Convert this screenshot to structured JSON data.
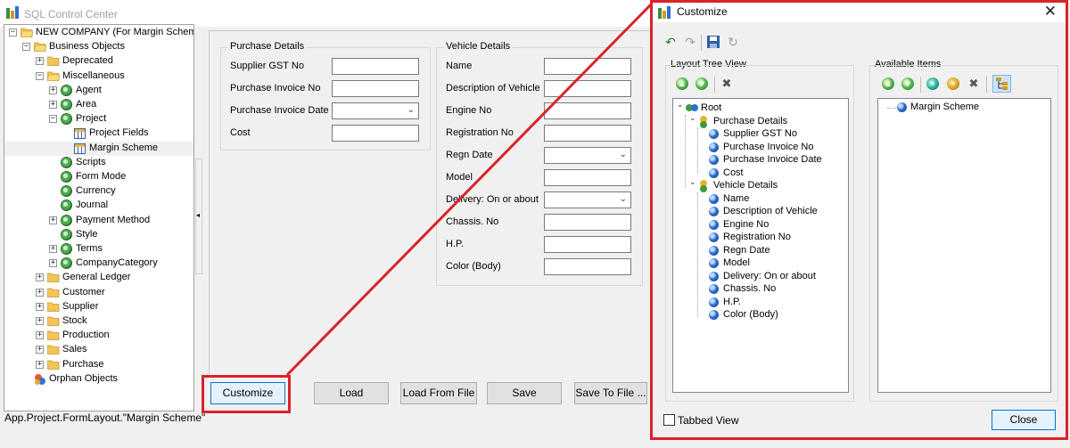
{
  "main_window": {
    "title": "SQL Control Center",
    "tree": [
      {
        "label": "NEW COMPANY (For Margin Scheme",
        "level": 0,
        "expander": "-",
        "icon": "folder-open-icon"
      },
      {
        "label": "Business Objects",
        "level": 1,
        "expander": "-",
        "icon": "folder-open-icon"
      },
      {
        "label": "Deprecated",
        "level": 2,
        "expander": "+",
        "icon": "folder-icon"
      },
      {
        "label": "Miscellaneous",
        "level": 2,
        "expander": "-",
        "icon": "folder-open-icon"
      },
      {
        "label": "Agent",
        "level": 3,
        "expander": "+",
        "icon": "gear-icon"
      },
      {
        "label": "Area",
        "level": 3,
        "expander": "+",
        "icon": "gear-icon"
      },
      {
        "label": "Project",
        "level": 3,
        "expander": "-",
        "icon": "gear-icon"
      },
      {
        "label": "Project Fields",
        "level": 4,
        "expander": "",
        "icon": "grid-icon"
      },
      {
        "label": "Margin Scheme",
        "level": 4,
        "expander": "",
        "icon": "grid-icon",
        "selected": true
      },
      {
        "label": "Scripts",
        "level": 3,
        "expander": "",
        "icon": "gear-icon"
      },
      {
        "label": "Form Mode",
        "level": 3,
        "expander": "",
        "icon": "gear-icon"
      },
      {
        "label": "Currency",
        "level": 3,
        "expander": "",
        "icon": "gear-icon"
      },
      {
        "label": "Journal",
        "level": 3,
        "expander": "",
        "icon": "gear-icon"
      },
      {
        "label": "Payment Method",
        "level": 3,
        "expander": "+",
        "icon": "gear-icon"
      },
      {
        "label": "Style",
        "level": 3,
        "expander": "",
        "icon": "gear-icon"
      },
      {
        "label": "Terms",
        "level": 3,
        "expander": "+",
        "icon": "gear-icon"
      },
      {
        "label": "CompanyCategory",
        "level": 3,
        "expander": "+",
        "icon": "gear-icon"
      },
      {
        "label": "General Ledger",
        "level": 2,
        "expander": "+",
        "icon": "folder-icon"
      },
      {
        "label": "Customer",
        "level": 2,
        "expander": "+",
        "icon": "folder-icon"
      },
      {
        "label": "Supplier",
        "level": 2,
        "expander": "+",
        "icon": "folder-icon"
      },
      {
        "label": "Stock",
        "level": 2,
        "expander": "+",
        "icon": "folder-icon"
      },
      {
        "label": "Production",
        "level": 2,
        "expander": "+",
        "icon": "folder-icon"
      },
      {
        "label": "Sales",
        "level": 2,
        "expander": "+",
        "icon": "folder-icon"
      },
      {
        "label": "Purchase",
        "level": 2,
        "expander": "+",
        "icon": "folder-icon"
      },
      {
        "label": "Orphan Objects",
        "level": 1,
        "expander": "",
        "icon": "orphan-icon"
      }
    ],
    "purchase_group": {
      "title": "Purchase Details",
      "fields": [
        {
          "label": "Supplier GST No",
          "kind": "text"
        },
        {
          "label": "Purchase Invoice No",
          "kind": "text"
        },
        {
          "label": "Purchase Invoice Date",
          "kind": "select"
        },
        {
          "label": "Cost",
          "kind": "text"
        }
      ]
    },
    "vehicle_group": {
      "title": "Vehicle Details",
      "fields": [
        {
          "label": "Name",
          "kind": "text"
        },
        {
          "label": "Description of Vehicle",
          "kind": "text"
        },
        {
          "label": "Engine No",
          "kind": "text"
        },
        {
          "label": "Registration No",
          "kind": "text"
        },
        {
          "label": "Regn Date",
          "kind": "select"
        },
        {
          "label": "Model",
          "kind": "text"
        },
        {
          "label": "Delivery: On or about",
          "kind": "select"
        },
        {
          "label": "Chassis. No",
          "kind": "text"
        },
        {
          "label": "H.P.",
          "kind": "text"
        },
        {
          "label": "Color (Body)",
          "kind": "text"
        }
      ]
    },
    "buttons": {
      "customize": "Customize",
      "load": "Load",
      "load_from_file": "Load From File ...",
      "save": "Save",
      "save_to_file": "Save To File ..."
    },
    "status": "App.Project.FormLayout.\"Margin Scheme\""
  },
  "dialog": {
    "title": "Customize",
    "close_glyph": "✕",
    "layout_tree_label": "Layout Tree View",
    "available_items_label": "Available Items",
    "layout_tree": [
      {
        "label": "Root",
        "level": 0,
        "icon": "root-icon",
        "caret": "⌄"
      },
      {
        "label": "Purchase Details",
        "level": 1,
        "icon": "group-icon",
        "caret": "⌄"
      },
      {
        "label": "Supplier GST No",
        "level": 2,
        "icon": "item-icon"
      },
      {
        "label": "Purchase Invoice No",
        "level": 2,
        "icon": "item-icon"
      },
      {
        "label": "Purchase Invoice Date",
        "level": 2,
        "icon": "item-icon"
      },
      {
        "label": "Cost",
        "level": 2,
        "icon": "item-icon"
      },
      {
        "label": "Vehicle Details",
        "level": 1,
        "icon": "group-icon",
        "caret": "⌄"
      },
      {
        "label": "Name",
        "level": 2,
        "icon": "item-icon"
      },
      {
        "label": "Description of Vehicle",
        "level": 2,
        "icon": "item-icon"
      },
      {
        "label": "Engine No",
        "level": 2,
        "icon": "item-icon"
      },
      {
        "label": "Registration No",
        "level": 2,
        "icon": "item-icon"
      },
      {
        "label": "Regn Date",
        "level": 2,
        "icon": "item-icon"
      },
      {
        "label": "Model",
        "level": 2,
        "icon": "item-icon"
      },
      {
        "label": "Delivery: On or about",
        "level": 2,
        "icon": "item-icon"
      },
      {
        "label": "Chassis. No",
        "level": 2,
        "icon": "item-icon"
      },
      {
        "label": "H.P.",
        "level": 2,
        "icon": "item-icon"
      },
      {
        "label": "Color (Body)",
        "level": 2,
        "icon": "item-icon"
      }
    ],
    "available_items": [
      {
        "label": "Margin Scheme",
        "icon": "item-icon"
      }
    ],
    "tabbed_view_label": "Tabbed View",
    "tabbed_view_checked": false,
    "close_label": "Close"
  },
  "colors": {
    "highlight_red": "#d8232a",
    "selection_blue": "#0078d7"
  }
}
